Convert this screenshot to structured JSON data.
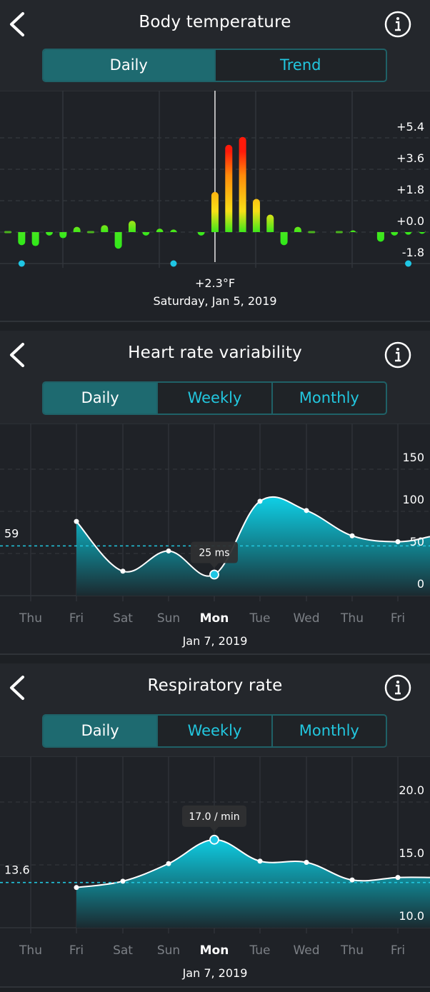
{
  "sections": {
    "body_temperature": {
      "title": "Body temperature",
      "tabs": [
        {
          "label": "Daily",
          "active": true
        },
        {
          "label": "Trend",
          "active": false
        }
      ],
      "selected_value": "+2.3°F",
      "selected_date": "Saturday, Jan 5, 2019"
    },
    "hrv": {
      "title": "Heart rate variability",
      "tabs": [
        {
          "label": "Daily",
          "active": true
        },
        {
          "label": "Weekly",
          "active": false
        },
        {
          "label": "Monthly",
          "active": false
        }
      ],
      "average_label": "59",
      "tooltip": "25 ms",
      "selected_date": "Jan 7, 2019"
    },
    "respiratory": {
      "title": "Respiratory rate",
      "tabs": [
        {
          "label": "Daily",
          "active": true
        },
        {
          "label": "Weekly",
          "active": false
        },
        {
          "label": "Monthly",
          "active": false
        }
      ],
      "average_label": "13.6",
      "tooltip": "17.0 / min",
      "selected_date": "Jan 7, 2019"
    }
  },
  "icons": {
    "back": "chevron-left-icon",
    "info": "info-circle-icon"
  },
  "colors": {
    "accent": "#22c7df",
    "segment_active": "#1e6a70",
    "bar_low": "#3ee81a",
    "bar_mid": "#f7e017",
    "bar_high": "#ff1a0a",
    "marker_dot": "#1fc6e4"
  },
  "chart_data": [
    {
      "type": "bar",
      "title": "Body temperature",
      "unit": "°F deviation",
      "yticks": [
        "+5.4",
        "+3.6",
        "+1.8",
        "+0.0",
        "-1.8"
      ],
      "ylim": [
        -1.8,
        5.4
      ],
      "selected_index": 15,
      "values": [
        0.0,
        -0.75,
        -0.8,
        -0.2,
        -0.35,
        0.3,
        0.05,
        0.4,
        -0.95,
        0.65,
        -0.2,
        0.2,
        0.15,
        null,
        -0.2,
        2.3,
        5.0,
        5.45,
        1.9,
        1.0,
        -0.75,
        0.3,
        0.03,
        null,
        0.03,
        0.1,
        null,
        -0.55,
        -0.2,
        -0.15,
        -0.1
      ],
      "marker_dots_at_index": [
        1,
        12,
        29
      ]
    },
    {
      "type": "area",
      "title": "Heart rate variability",
      "unit": "ms",
      "categories": [
        "Thu",
        "Fri",
        "Sat",
        "Sun",
        "Mon",
        "Tue",
        "Wed",
        "Thu",
        "Fri"
      ],
      "selected_category_index": 4,
      "values": [
        null,
        88,
        29,
        53,
        25,
        112,
        101,
        71,
        64
      ],
      "right_edge_value": 70,
      "average": 59,
      "yticks": [
        "150",
        "100",
        "50",
        "0"
      ],
      "ylim": [
        0,
        150
      ]
    },
    {
      "type": "area",
      "title": "Respiratory rate",
      "unit": "/ min",
      "categories": [
        "Thu",
        "Fri",
        "Sat",
        "Sun",
        "Mon",
        "Tue",
        "Wed",
        "Thu",
        "Fri"
      ],
      "selected_category_index": 4,
      "values": [
        null,
        13.2,
        13.7,
        15.1,
        17.0,
        15.3,
        15.2,
        13.8,
        14.0
      ],
      "right_edge_value": 14.0,
      "average": 13.6,
      "yticks": [
        "20.0",
        "15.0",
        "10.0"
      ],
      "ylim": [
        10,
        20
      ]
    }
  ]
}
